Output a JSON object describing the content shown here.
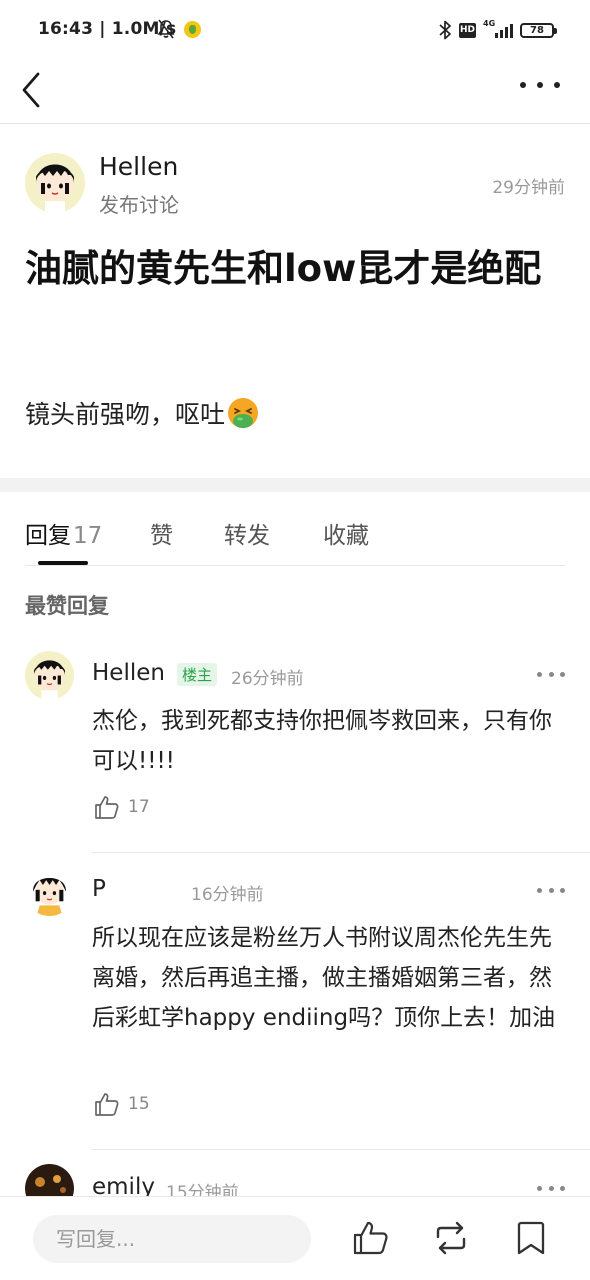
{
  "status_bar": {
    "time": "16:43 | 1.0M/s",
    "network": "4G",
    "hd": "HD",
    "battery": "78"
  },
  "post": {
    "author": "Hellen",
    "action": "发布讨论",
    "time": "29分钟前",
    "title": "油腻的黄先生和low昆才是绝配",
    "body": "镜头前强吻，呕吐"
  },
  "tabs": [
    {
      "label": "回复",
      "count": "17"
    },
    {
      "label": "赞"
    },
    {
      "label": "转发"
    },
    {
      "label": "收藏"
    }
  ],
  "section_title": "最赞回复",
  "replies": [
    {
      "name": "Hellen",
      "badge": "楼主",
      "time": "26分钟前",
      "text": "杰伦，我到死都支持你把佩岑救回来，只有你可以!!!!",
      "likes": "17"
    },
    {
      "name": "P",
      "time": "16分钟前",
      "text": "所以现在应该是粉丝万人书附议周杰伦先生先离婚，然后再追主播，做主播婚姻第三者，然后彩虹学happy endiing吗？顶你上去！加油",
      "likes": "15"
    },
    {
      "name": "emily",
      "time": "15分钟前"
    }
  ],
  "bottom_bar": {
    "placeholder": "写回复..."
  },
  "icons": {
    "back": "chevron-left-icon",
    "more": "more-horizontal-icon",
    "like": "thumbs-up-icon",
    "repost": "repost-icon",
    "bookmark": "bookmark-icon",
    "emoji": "nauseated-face-emoji"
  },
  "colors": {
    "badge_green": "#2aa34a",
    "secondary_text": "#9a9a9a",
    "divider": "#e8e8e8"
  }
}
